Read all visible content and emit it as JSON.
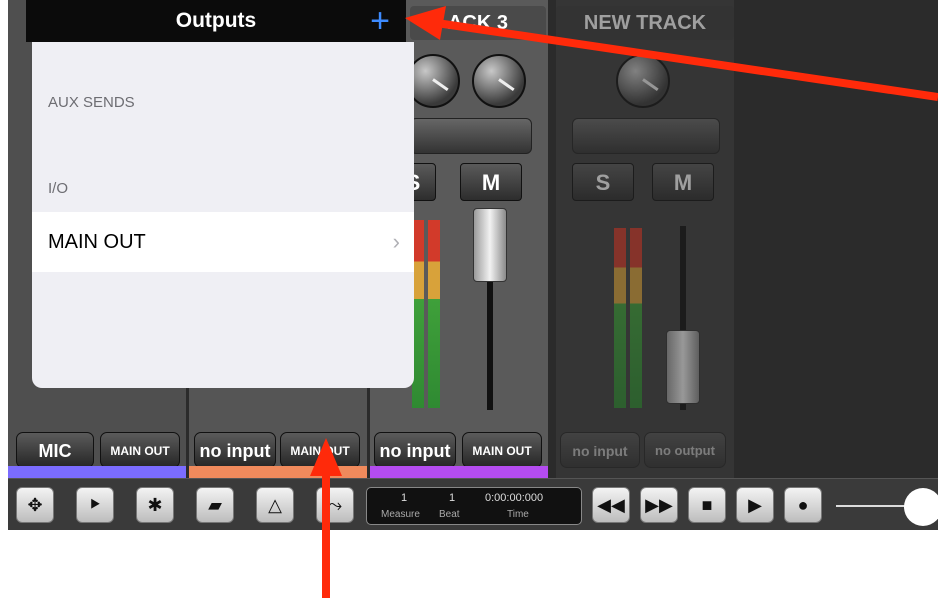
{
  "popover": {
    "title": "Outputs",
    "add_label": "+",
    "sections": [
      {
        "header": "AUX SENDS"
      },
      {
        "header": "I/O",
        "items": [
          {
            "label": "MAIN OUT",
            "chevron": "›"
          }
        ]
      }
    ]
  },
  "mixer": {
    "track3_title": "ACK 3",
    "new_track_title": "NEW TRACK",
    "track3_solo": "S",
    "track3_mute": "M",
    "new_solo": "S",
    "new_mute": "M",
    "strips": [
      {
        "input": "MIC",
        "output": "MAIN OUT",
        "color": "#7b6cff"
      },
      {
        "input": "no input",
        "output": "MAIN OUT",
        "color": "#f08a5c"
      },
      {
        "input": "no input",
        "output": "MAIN OUT",
        "color": "#b44cf0"
      },
      {
        "input": "no input",
        "output": "no output"
      }
    ]
  },
  "transport": {
    "measure_value": "1",
    "beat_value": "1",
    "time_value": "0:00:00:000",
    "measure_label": "Measure",
    "beat_label": "Beat",
    "time_label": "Time"
  },
  "toolbar_icons": [
    "move-icon",
    "fast-forward-marker-icon",
    "gear-icon",
    "folder-icon",
    "metronome-icon",
    "loop-icon",
    "rewind-icon",
    "fast-forward-icon",
    "stop-icon",
    "play-icon",
    "record-icon"
  ],
  "annotation_color": "#ff2a0a"
}
